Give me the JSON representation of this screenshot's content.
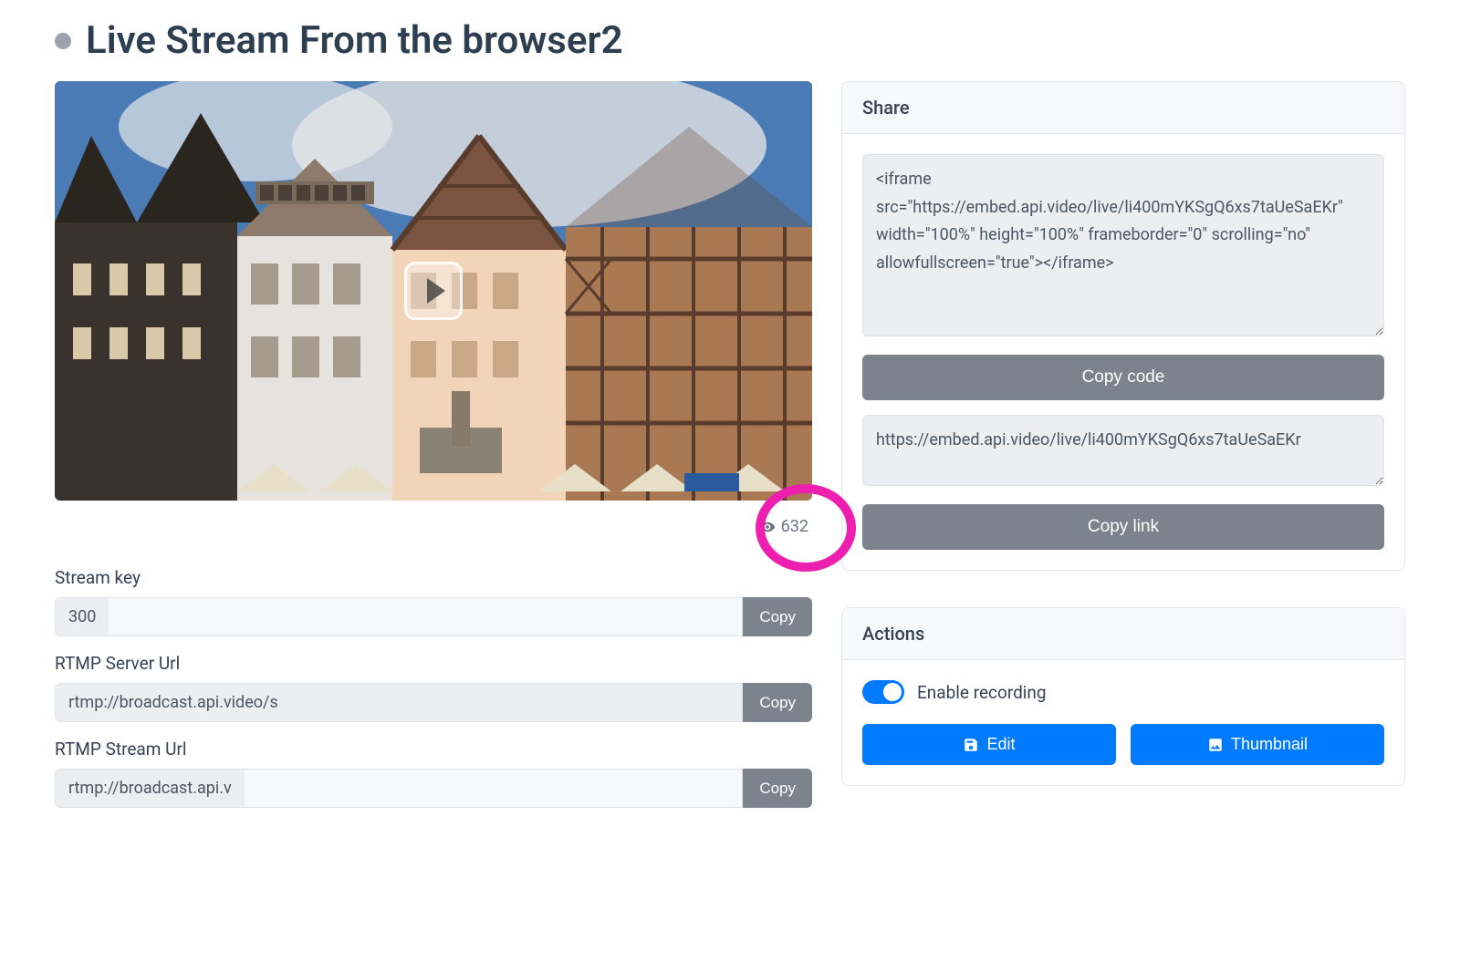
{
  "header": {
    "title": "Live Stream From the browser2",
    "status": "offline"
  },
  "views": {
    "count": "632"
  },
  "stream": {
    "key_label": "Stream key",
    "key_value": "300",
    "rtmp_server_label": "RTMP Server Url",
    "rtmp_server_value": "rtmp://broadcast.api.video/s",
    "rtmp_stream_label": "RTMP Stream Url",
    "rtmp_stream_value": "rtmp://broadcast.api.v",
    "copy_label": "Copy"
  },
  "share": {
    "panel_title": "Share",
    "iframe_code": "<iframe src=\"https://embed.api.video/live/li400mYKSgQ6xs7taUeSaEKr\" width=\"100%\" height=\"100%\" frameborder=\"0\" scrolling=\"no\" allowfullscreen=\"true\"></iframe>",
    "copy_code_label": "Copy code",
    "link_value": "https://embed.api.video/live/li400mYKSgQ6xs7taUeSaEKr",
    "copy_link_label": "Copy link"
  },
  "actions": {
    "panel_title": "Actions",
    "recording_label": "Enable recording",
    "recording_enabled": true,
    "edit_label": "Edit",
    "thumbnail_label": "Thumbnail"
  }
}
